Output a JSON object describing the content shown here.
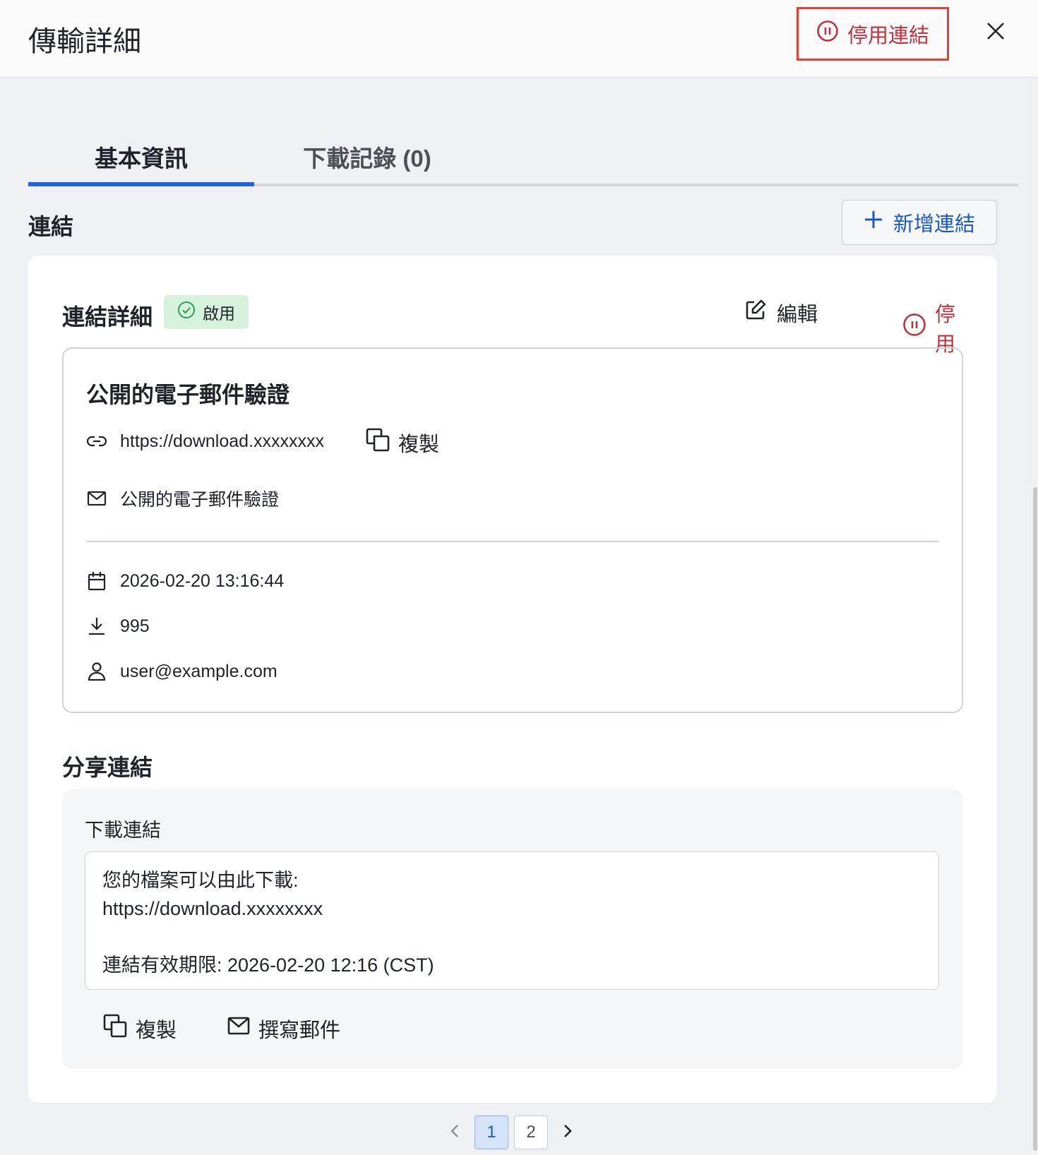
{
  "header": {
    "title": "傳輸詳細",
    "disable_link_label": "停用連結"
  },
  "tabs": [
    {
      "label": "基本資訊",
      "active": true
    },
    {
      "label": "下載記錄 (0)",
      "active": false
    }
  ],
  "links_section": {
    "title": "連結",
    "add_link_label": "新增連結"
  },
  "link_detail": {
    "title": "連結詳細",
    "status_label": "啟用",
    "edit_label": "編輯",
    "disable_label": "停用",
    "name": "公開的電子郵件驗證",
    "url": "https://download.xxxxxxxx",
    "copy_label": "複製",
    "access_type": "公開的電子郵件驗證",
    "expiry_datetime": "2026-02-20 13:16:44",
    "download_count": "995",
    "creator": "user@example.com"
  },
  "share_section": {
    "title": "分享連結",
    "field_label": "下載連結",
    "message": "您的檔案可以由此下載:\nhttps://download.xxxxxxxx\n\n連結有效期限: 2026-02-20 12:16 (CST)",
    "copy_label": "複製",
    "compose_label": "撰寫郵件"
  },
  "pagination": {
    "pages": [
      "1",
      "2"
    ],
    "current": "1"
  },
  "colors": {
    "accent": "#2563d6",
    "danger": "#c0313f",
    "highlight_border": "#e5402f",
    "success_bg": "#d6f2dc",
    "success_icon": "#2f9e4f"
  }
}
